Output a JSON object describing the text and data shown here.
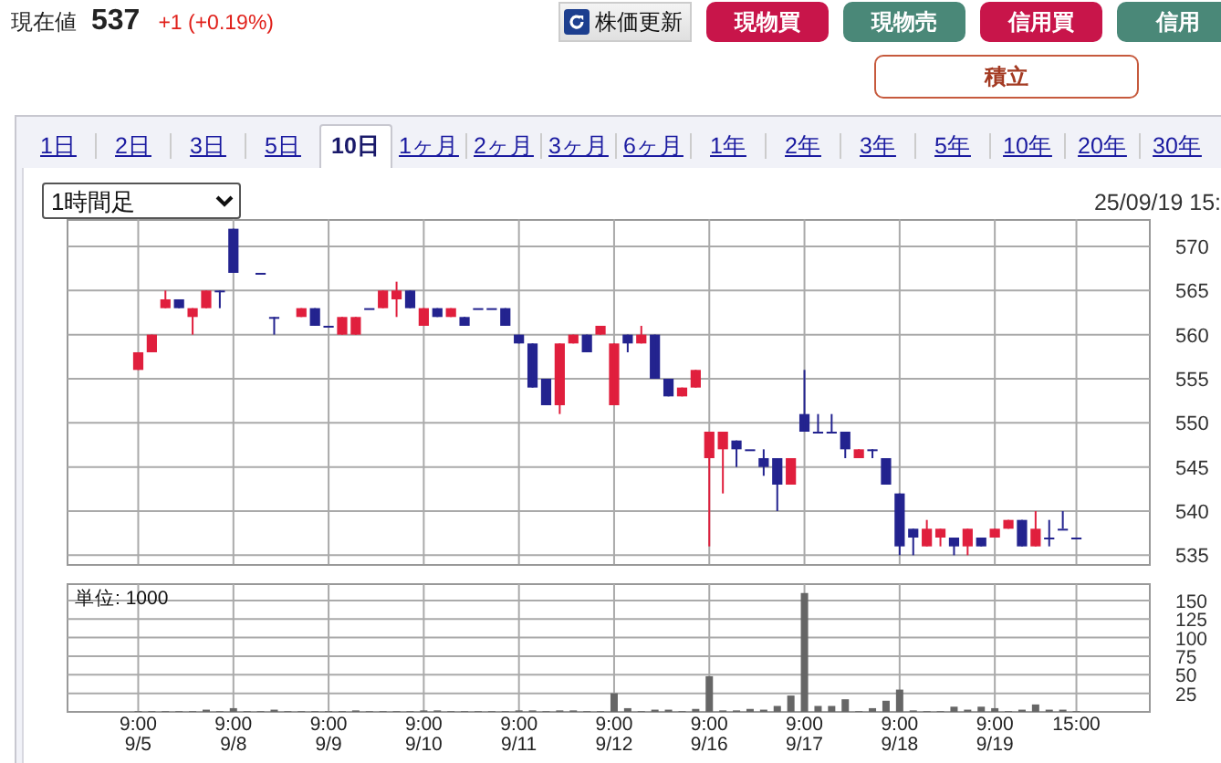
{
  "quote": {
    "label": "現在値",
    "price": "537",
    "change": "+1 (+0.19%)"
  },
  "buttons": [
    {
      "kind": "refresh",
      "label": "株価更新"
    },
    {
      "kind": "buy",
      "label": "現物買"
    },
    {
      "kind": "sell",
      "label": "現物売"
    },
    {
      "kind": "buy",
      "label": "信用買"
    },
    {
      "kind": "sell",
      "label": "信用"
    }
  ],
  "accumulate_button": {
    "label": "積立"
  },
  "tabs": [
    {
      "label": "1日",
      "selected": false
    },
    {
      "label": "2日",
      "selected": false
    },
    {
      "label": "3日",
      "selected": false
    },
    {
      "label": "5日",
      "selected": false
    },
    {
      "label": "10日",
      "selected": true
    },
    {
      "label": "1ヶ月",
      "selected": false
    },
    {
      "label": "2ヶ月",
      "selected": false
    },
    {
      "label": "3ヶ月",
      "selected": false
    },
    {
      "label": "6ヶ月",
      "selected": false
    },
    {
      "label": "1年",
      "selected": false
    },
    {
      "label": "2年",
      "selected": false
    },
    {
      "label": "3年",
      "selected": false
    },
    {
      "label": "5年",
      "selected": false
    },
    {
      "label": "10年",
      "selected": false
    },
    {
      "label": "20年",
      "selected": false
    },
    {
      "label": "30年",
      "selected": false
    }
  ],
  "interval_select": {
    "value": "1時間足"
  },
  "timestamp": "25/09/19 15:",
  "price_chart": {
    "chart_data": {
      "type": "candlestick",
      "grid": true,
      "ylim": [
        534,
        573.1
      ],
      "yticks": [
        535,
        540,
        545,
        550,
        555,
        560,
        565,
        570
      ],
      "categories": [
        null,
        null,
        null,
        null,
        null,
        null,
        null,
        null,
        null,
        null,
        null,
        null,
        null,
        null,
        null,
        null,
        null,
        null,
        null,
        null,
        null,
        null,
        null,
        null,
        null,
        null,
        null,
        null,
        null,
        null,
        null,
        null,
        null,
        null,
        null,
        null,
        null,
        null,
        null,
        null,
        null,
        null,
        null,
        null,
        null,
        null,
        null,
        null,
        null,
        null,
        null,
        null,
        null,
        null,
        null,
        null,
        null,
        null,
        null,
        null,
        null,
        null,
        null,
        null,
        null,
        null,
        null,
        null,
        null,
        null
      ],
      "ohlc": [
        [
          556,
          558,
          556,
          558
        ],
        [
          558,
          560,
          558,
          560
        ],
        [
          563,
          565,
          563,
          564
        ],
        [
          564,
          564,
          563,
          563
        ],
        [
          562,
          563,
          560,
          563
        ],
        [
          563,
          565,
          563,
          565
        ],
        [
          565,
          565,
          563,
          565
        ],
        [
          572,
          572,
          567,
          567
        ],
        null,
        [
          567,
          567,
          567,
          567
        ],
        [
          562,
          562,
          560,
          562
        ],
        null,
        [
          562,
          563,
          562,
          563
        ],
        [
          563,
          563,
          561,
          561
        ],
        [
          561,
          561,
          561,
          561
        ],
        [
          560,
          562,
          560,
          562
        ],
        [
          560,
          562,
          560,
          562
        ],
        [
          563,
          563,
          563,
          563
        ],
        [
          563,
          565,
          563,
          565
        ],
        [
          564,
          566,
          562,
          565
        ],
        [
          565,
          565,
          563,
          563
        ],
        [
          561,
          563,
          561,
          563
        ],
        [
          563,
          563,
          562,
          562
        ],
        [
          562,
          563,
          562,
          563
        ],
        [
          562,
          562,
          561,
          561
        ],
        [
          563,
          563,
          563,
          563
        ],
        [
          563,
          563,
          563,
          563
        ],
        [
          563,
          563,
          561,
          561
        ],
        [
          560,
          560,
          559,
          559
        ],
        [
          559,
          559,
          554,
          554
        ],
        [
          555,
          555,
          552,
          552
        ],
        [
          552,
          559,
          551,
          559
        ],
        [
          559,
          560,
          559,
          560
        ],
        [
          560,
          560,
          558,
          558
        ],
        [
          560,
          561,
          560,
          561
        ],
        [
          552,
          559,
          552,
          559
        ],
        [
          560,
          560,
          558,
          559
        ],
        [
          559,
          561,
          559,
          560
        ],
        [
          560,
          560,
          555,
          555
        ],
        [
          555,
          555,
          553,
          553
        ],
        [
          553,
          554,
          553,
          554
        ],
        [
          554,
          556,
          554,
          556
        ],
        [
          546,
          549,
          536,
          549
        ],
        [
          547,
          549,
          542,
          549
        ],
        [
          548,
          548,
          545,
          547
        ],
        [
          547,
          547,
          547,
          547
        ],
        [
          546,
          547,
          544,
          545
        ],
        [
          546,
          546,
          540,
          543
        ],
        [
          543,
          546,
          543,
          546
        ],
        [
          551,
          556,
          549,
          549
        ],
        [
          549,
          551,
          549,
          549
        ],
        [
          549,
          551,
          549,
          549
        ],
        [
          549,
          549,
          546,
          547
        ],
        [
          546,
          547,
          546,
          547
        ],
        [
          547,
          547,
          546,
          547
        ],
        [
          546,
          546,
          543,
          543
        ],
        [
          542,
          542,
          535,
          536
        ],
        [
          538,
          538,
          535,
          537
        ],
        [
          536,
          539,
          536,
          538
        ],
        [
          537,
          538,
          536,
          538
        ],
        [
          537,
          537,
          535,
          536
        ],
        [
          536,
          538,
          535,
          538
        ],
        [
          537,
          537,
          536,
          536
        ],
        [
          537,
          538,
          537,
          538
        ],
        [
          538,
          539,
          538,
          539
        ],
        [
          539,
          539,
          536,
          536
        ],
        [
          536,
          540,
          536,
          538
        ],
        [
          537,
          539,
          536,
          537
        ],
        [
          538,
          540,
          538,
          538
        ],
        [
          537,
          537,
          537,
          537
        ]
      ]
    }
  },
  "volume_chart": {
    "label": "単位: 1000",
    "chart_data": {
      "type": "bar",
      "grid": true,
      "ylim": [
        0,
        172
      ],
      "yticks": [
        25,
        50,
        75,
        100,
        125,
        150
      ],
      "categories": [
        "9:00 9/5",
        null,
        null,
        null,
        null,
        null,
        null,
        "9:00 9/8",
        null,
        null,
        null,
        null,
        null,
        null,
        "9:00 9/9",
        null,
        null,
        null,
        null,
        null,
        null,
        "9:00 9/10",
        null,
        null,
        null,
        null,
        null,
        null,
        "9:00 9/11",
        null,
        null,
        null,
        null,
        null,
        null,
        "9:00 9/12",
        null,
        null,
        null,
        null,
        null,
        null,
        "9:00 9/16",
        null,
        null,
        null,
        null,
        null,
        null,
        "9:00 9/17",
        null,
        null,
        null,
        null,
        null,
        null,
        "9:00 9/18",
        null,
        null,
        null,
        null,
        null,
        null,
        "9:00 9/19",
        null,
        null,
        null,
        null,
        null,
        "15:00"
      ],
      "series": [
        {
          "color": "#666666",
          "values": [
            1,
            1,
            1,
            1,
            1,
            3,
            1,
            5,
            1,
            1,
            3,
            1,
            1,
            1,
            1,
            1,
            2,
            1,
            1,
            1,
            1,
            2,
            2,
            1,
            1,
            1,
            1,
            1,
            2,
            2,
            1,
            2,
            2,
            1,
            1,
            25,
            5,
            1,
            3,
            3,
            1,
            4,
            48,
            2,
            2,
            4,
            3,
            8,
            22,
            160,
            8,
            8,
            17,
            1,
            5,
            15,
            30,
            2,
            1,
            1,
            7,
            3,
            7,
            5,
            1,
            3,
            10,
            3,
            3,
            1
          ]
        }
      ]
    }
  }
}
